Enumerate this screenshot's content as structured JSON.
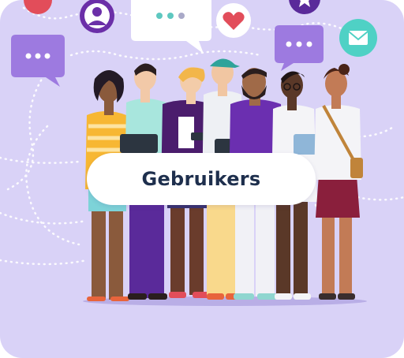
{
  "card": {
    "label": "Gebruikers"
  },
  "colors": {
    "background": "#d9d2f7",
    "label_text": "#1e2f4d",
    "accent_purple": "#7b4ad6",
    "accent_red": "#e24d5a",
    "accent_teal": "#4fd1c5"
  },
  "icons": [
    "user-avatar-icon",
    "chat-bubble-icon",
    "heart-icon",
    "mail-icon",
    "star-icon"
  ]
}
